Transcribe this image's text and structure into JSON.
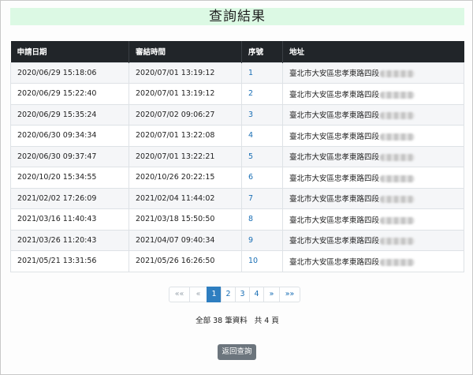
{
  "page": {
    "title": "查詢結果"
  },
  "table": {
    "headers": [
      "申請日期",
      "審結時間",
      "序號",
      "地址"
    ],
    "rows": [
      {
        "apply": "2020/06/29 15:18:06",
        "done": "2020/07/01 13:19:12",
        "seq": "1",
        "addr": "臺北市大安區忠孝東路四段"
      },
      {
        "apply": "2020/06/29 15:22:40",
        "done": "2020/07/01 13:19:12",
        "seq": "2",
        "addr": "臺北市大安區忠孝東路四段"
      },
      {
        "apply": "2020/06/29 15:35:24",
        "done": "2020/07/02 09:06:27",
        "seq": "3",
        "addr": "臺北市大安區忠孝東路四段"
      },
      {
        "apply": "2020/06/30 09:34:34",
        "done": "2020/07/01 13:22:08",
        "seq": "4",
        "addr": "臺北市大安區忠孝東路四段"
      },
      {
        "apply": "2020/06/30 09:37:47",
        "done": "2020/07/01 13:22:21",
        "seq": "5",
        "addr": "臺北市大安區忠孝東路四段"
      },
      {
        "apply": "2020/10/20 15:34:55",
        "done": "2020/10/26 20:22:15",
        "seq": "6",
        "addr": "臺北市大安區忠孝東路四段"
      },
      {
        "apply": "2021/02/02 17:26:09",
        "done": "2021/02/04 11:44:02",
        "seq": "7",
        "addr": "臺北市大安區忠孝東路四段"
      },
      {
        "apply": "2021/03/16 11:40:43",
        "done": "2021/03/18 15:50:50",
        "seq": "8",
        "addr": "臺北市大安區忠孝東路四段"
      },
      {
        "apply": "2021/03/26 11:20:43",
        "done": "2021/04/07 09:40:34",
        "seq": "9",
        "addr": "臺北市大安區忠孝東路四段"
      },
      {
        "apply": "2021/05/21 13:31:56",
        "done": "2021/05/26 16:26:50",
        "seq": "10",
        "addr": "臺北市大安區忠孝東路四段"
      }
    ]
  },
  "pagination": {
    "first": "««",
    "prev": "«",
    "pages": [
      "1",
      "2",
      "3",
      "4"
    ],
    "active_page": "1",
    "next": "»",
    "last": "»»"
  },
  "summary": {
    "total_text": "全部 38 筆資料",
    "pages_text": "共 4 頁"
  },
  "buttons": {
    "back": "返回查詢"
  },
  "colors": {
    "title_bg": "#dcf9e4",
    "header_bg": "#212529",
    "link": "#1a6fb5",
    "active_page": "#2e7ec0",
    "back_button": "#6c757d"
  }
}
